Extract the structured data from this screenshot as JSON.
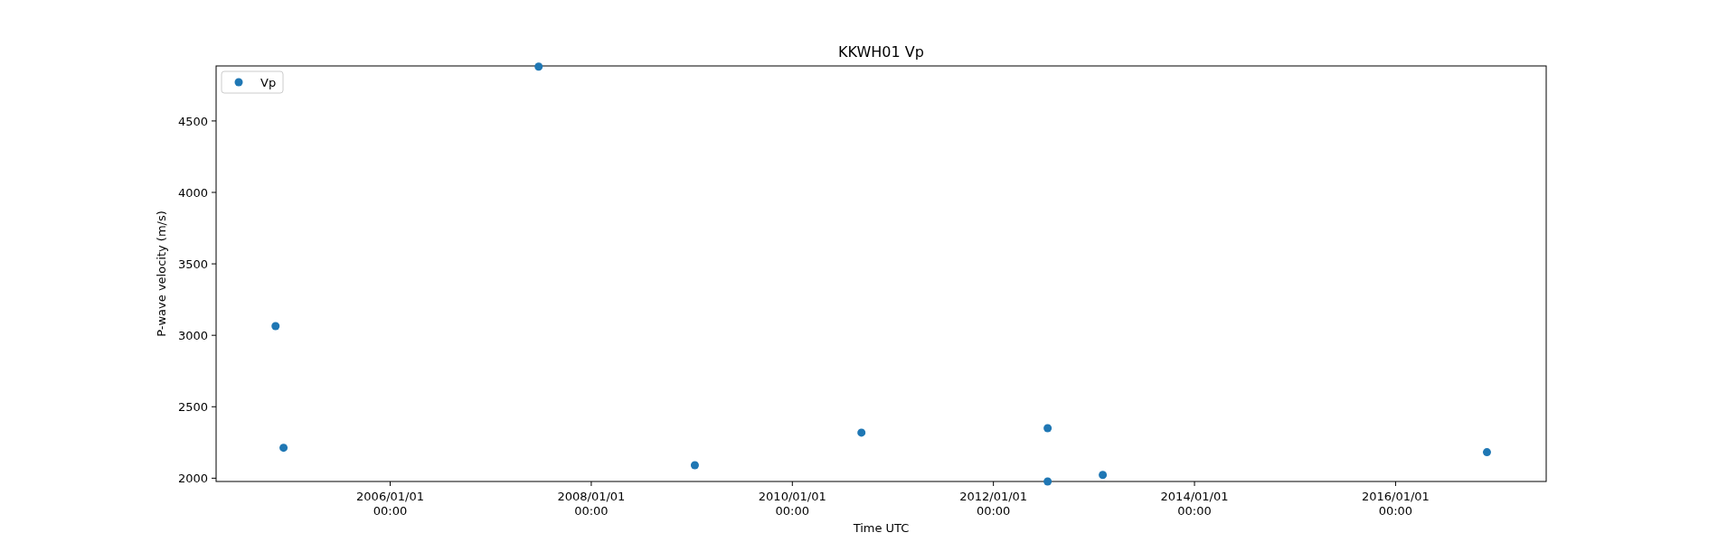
{
  "figure": {
    "chart_data": {
      "type": "scatter",
      "title": "KKWH01 Vp",
      "xlabel": "Time UTC",
      "ylabel": "P-wave velocity (m/s)",
      "x": [
        "2004-11-10",
        "2004-12-09",
        "2007-06-24",
        "2009-01-12",
        "2010-09-09",
        "2012-07-16",
        "2012-07-16",
        "2013-02-02",
        "2016-11-28"
      ],
      "series": [
        {
          "name": "Vp",
          "color": "#1f77b4",
          "values": [
            3064,
            2213,
            4880,
            2091,
            2319,
            2350,
            1977,
            2023,
            2182
          ]
        }
      ],
      "xlim": [
        "2004-04-08",
        "2017-07-02"
      ],
      "ylim": [
        1977,
        4885
      ],
      "xticks": [
        {
          "value": "2006-01-01",
          "label": "2006/01/01 00:00"
        },
        {
          "value": "2008-01-01",
          "label": "2008/01/01 00:00"
        },
        {
          "value": "2010-01-01",
          "label": "2010/01/01 00:00"
        },
        {
          "value": "2012-01-01",
          "label": "2012/01/01 00:00"
        },
        {
          "value": "2014-01-01",
          "label": "2014/01/01 00:00"
        },
        {
          "value": "2016-01-01",
          "label": "2016/01/01 00:00"
        }
      ],
      "yticks": [
        2000,
        2500,
        3000,
        3500,
        4000,
        4500
      ]
    }
  }
}
